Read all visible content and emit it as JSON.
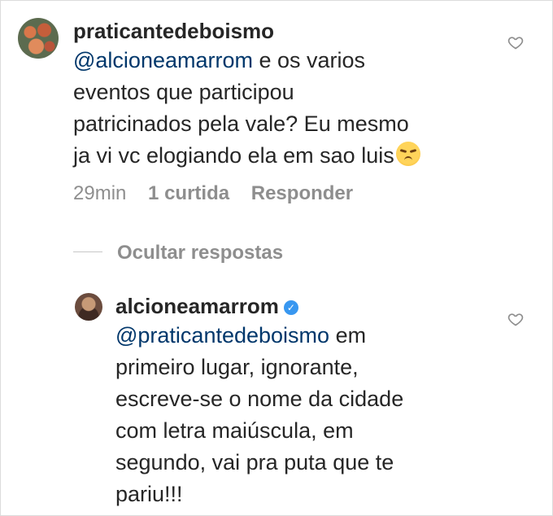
{
  "thread": {
    "comment": {
      "username": "praticantedeboismo",
      "mention": "@alcioneamarrom",
      "text_lines": [
        " e os varios",
        "eventos que participou",
        "patricinados pela vale? Eu mesmo",
        "ja vi vc elogiando ela em sao luis"
      ],
      "emoji": "unamused-face-emoji",
      "time": "29min",
      "likes": "1 curtida",
      "reply_label": "Responder"
    },
    "toggle_label": "Ocultar respostas",
    "reply": {
      "username": "alcioneamarrom",
      "verified_icon": "verified-badge-icon",
      "mention": "@praticantedeboismo",
      "text_lines": [
        " em",
        "primeiro lugar, ignorante,",
        "escreve-se o nome da cidade",
        "com letra maiúscula, em",
        "segundo, vai pra puta que te",
        "pariu!!!"
      ]
    }
  },
  "colors": {
    "text": "#262626",
    "mention": "#00376b",
    "meta": "#8e8e8e",
    "verified": "#3897f0"
  }
}
